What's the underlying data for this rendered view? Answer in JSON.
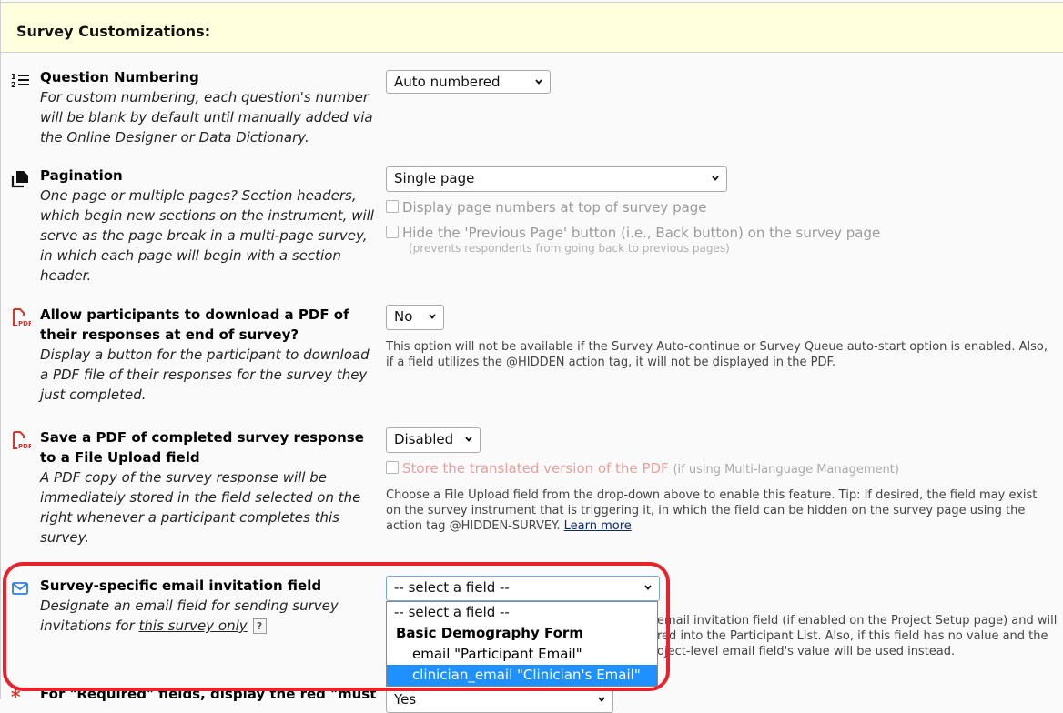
{
  "header": {
    "title": "Survey Customizations:"
  },
  "settings": {
    "question_numbering": {
      "title": "Question Numbering",
      "desc": "For custom numbering, each question's number will be blank by default until manually added via the Online Designer or Data Dictionary.",
      "icon": "numbered-list-icon",
      "value": "Auto numbered"
    },
    "pagination": {
      "title": "Pagination",
      "desc": "One page or multiple pages? Section headers, which begin new sections on the instrument, will serve as the page break in a multi-page survey, in which each page will begin with a section header.",
      "icon": "copy-pages-icon",
      "value": "Single page",
      "checkbox1": "Display page numbers at top of survey page",
      "checkbox2": "Hide the 'Previous Page' button (i.e., Back button) on the survey page",
      "checkbox2_note": "(prevents respondents from going back to previous pages)"
    },
    "pdf_download": {
      "title": "Allow participants to download a PDF of their responses at end of survey?",
      "desc": "Display a button for the participant to download a PDF file of their responses for the survey they just completed.",
      "icon": "pdf-file-icon",
      "value": "No",
      "note": "This option will not be available if the Survey Auto-continue or Survey Queue auto-start option is enabled. Also, if a field utilizes the @HIDDEN action tag, it will not be displayed in the PDF."
    },
    "pdf_save": {
      "title": "Save a PDF of completed survey response to a File Upload field",
      "desc": "A PDF copy of the survey response will be immediately stored in the field selected on the right whenever a participant completes this survey.",
      "icon": "pdf-file-icon",
      "value": "Disabled",
      "checkbox": "Store the translated version of the PDF",
      "checkbox_note": "(if using Multi-language Management)",
      "note": "Choose a File Upload field from the drop-down above to enable this feature. Tip: If desired, the field may exist on the survey instrument that is triggering it, in which the field can be hidden on the survey page using the action tag @HIDDEN-SURVEY.",
      "learn_more": "Learn more"
    },
    "email_field": {
      "title": "Survey-specific email invitation field",
      "desc_prefix": "Designate an email field for sending survey invitations for ",
      "desc_link": "this survey only",
      "help": "?",
      "icon": "envelope-icon",
      "value": "-- select a field --",
      "note_fragment_1": "email invitation field (if enabled on the Project Setup page) and will",
      "note_fragment_2": "red into the Participant List. Also, if this field has no value and the",
      "note_fragment_3": "oject-level email field's value will be used instead.",
      "dropdown": {
        "placeholder": "-- select a field --",
        "group": "Basic Demography Form",
        "options": [
          "email \"Participant Email\"",
          "clinician_email \"Clinician's Email\""
        ],
        "highlighted_index": 1
      }
    },
    "required_fields": {
      "title": "For \"Required\" fields, display the red \"must",
      "icon": "asterisk-icon",
      "value": "Yes"
    }
  },
  "colors": {
    "header_bg": "#fffedd",
    "highlight_border": "#e8222b",
    "dropdown_selected": "#1e90ff",
    "pdf_icon": "#d9352b",
    "email_icon": "#2f7de1"
  }
}
